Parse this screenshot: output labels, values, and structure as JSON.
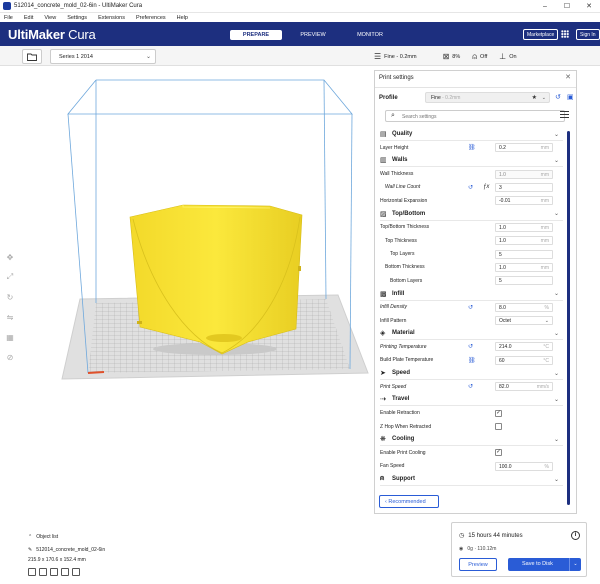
{
  "window": {
    "title": "512014_concrete_mold_02-6in - UltiMaker Cura"
  },
  "menu": [
    "File",
    "Edit",
    "View",
    "Settings",
    "Extensions",
    "Preferences",
    "Help"
  ],
  "header": {
    "brand": "UltiMaker",
    "brand_suffix": "Cura",
    "stages": [
      "PREPARE",
      "PREVIEW",
      "MONITOR"
    ],
    "active_stage": "PREPARE",
    "marketplace": "Marketplace",
    "signin": "Sign In"
  },
  "toolbar": {
    "printer": "Series 1 2014",
    "profile_summary": "Fine - 0.2mm",
    "infill": "8%",
    "support": "Off",
    "adhesion": "On"
  },
  "objects": {
    "title": "Object list",
    "name": "512014_concrete_mold_02-6in",
    "dimensions": "215.9 x 170.6 x 152.4 mm"
  },
  "panel": {
    "title": "Print settings",
    "profile_label": "Profile",
    "profile_value": "Fine",
    "profile_hint": " - 0.2mm",
    "search_placeholder": "Search settings",
    "recommended": "Recommended",
    "sections": [
      {
        "title": "Quality",
        "icon": "quality-icon",
        "rows": [
          {
            "label": "Layer Height",
            "value": "0.2",
            "unit": "mm",
            "link": true
          }
        ]
      },
      {
        "title": "Walls",
        "icon": "walls-icon",
        "rows": [
          {
            "label": "Wall Thickness",
            "value": "1.0",
            "unit": "mm",
            "dim": true
          },
          {
            "label": "Wall Line Count",
            "value": "3",
            "unit": "",
            "indent": 1,
            "italic": true,
            "reset": true,
            "fx": true
          },
          {
            "label": "Horizontal Expansion",
            "value": "-0.01",
            "unit": "mm"
          }
        ]
      },
      {
        "title": "Top/Bottom",
        "icon": "top-bottom-icon",
        "rows": [
          {
            "label": "Top/Bottom Thickness",
            "value": "1.0",
            "unit": "mm"
          },
          {
            "label": "Top Thickness",
            "value": "1.0",
            "unit": "mm",
            "indent": 1
          },
          {
            "label": "Top Layers",
            "value": "5",
            "unit": "",
            "indent": 2
          },
          {
            "label": "Bottom Thickness",
            "value": "1.0",
            "unit": "mm",
            "indent": 1
          },
          {
            "label": "Bottom Layers",
            "value": "5",
            "unit": "",
            "indent": 2
          }
        ]
      },
      {
        "title": "Infill",
        "icon": "infill-icon",
        "rows": [
          {
            "label": "Infill Density",
            "value": "8.0",
            "unit": "%",
            "italic": true,
            "reset": true
          },
          {
            "label": "Infill Pattern",
            "value": "Octet",
            "unit": "⌄",
            "select": true
          }
        ]
      },
      {
        "title": "Material",
        "icon": "material-icon",
        "rows": [
          {
            "label": "Printing Temperature",
            "value": "214.0",
            "unit": "°C",
            "italic": true,
            "reset": true
          },
          {
            "label": "Build Plate Temperature",
            "value": "60",
            "unit": "°C",
            "link": true
          }
        ]
      },
      {
        "title": "Speed",
        "icon": "speed-icon",
        "rows": [
          {
            "label": "Print Speed",
            "value": "82.0",
            "unit": "mm/s",
            "italic": true,
            "reset": true
          }
        ]
      },
      {
        "title": "Travel",
        "icon": "travel-icon",
        "rows": [
          {
            "label": "Enable Retraction",
            "check": true
          },
          {
            "label": "Z Hop When Retracted",
            "check": false
          }
        ]
      },
      {
        "title": "Cooling",
        "icon": "cooling-icon",
        "rows": [
          {
            "label": "Enable Print Cooling",
            "check": true
          },
          {
            "label": "Fan Speed",
            "value": "100.0",
            "unit": "%"
          }
        ]
      },
      {
        "title": "Support",
        "icon": "support-icon",
        "rows": []
      }
    ]
  },
  "job": {
    "time": "15 hours 44 minutes",
    "material": "0g · 110.12m",
    "preview": "Preview",
    "save": "Save to Disk"
  },
  "colors": {
    "brand_blue": "#1d2f7f",
    "accent_blue": "#2a5cd6",
    "model_yellow": "#f9e435"
  }
}
